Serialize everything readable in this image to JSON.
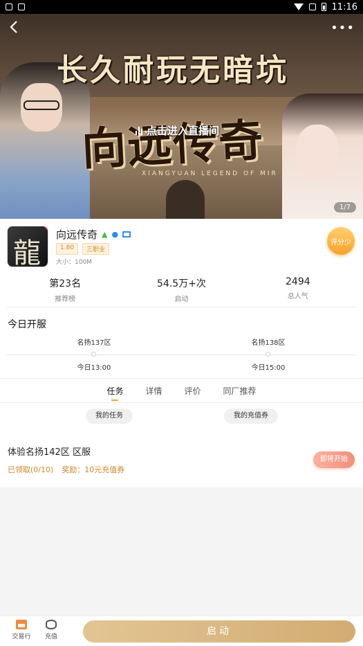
{
  "status_bar": {
    "time": "11:16"
  },
  "banner": {
    "slogan": "长久耐玩无暗坑",
    "game_logo": "向远传奇",
    "game_logo_sub": "XIANGYUAN LEGEND OF MIR",
    "live_label": "点击进入直播间",
    "page_indicator": "1/7"
  },
  "app": {
    "name": "向远传奇",
    "platform_icons": [
      "android-icon",
      "apple-icon",
      "pc-icon"
    ],
    "tags": [
      "1.80",
      "三职业"
    ],
    "size_label": "大小：100M",
    "rate_button": "评分少",
    "icon_char": "龍"
  },
  "stats": [
    {
      "value": "第23名",
      "label": "推荐榜"
    },
    {
      "value": "54.5万+次",
      "label": "启动"
    },
    {
      "value": "2494",
      "label": "总人气"
    }
  ],
  "today_servers": {
    "title": "今日开服",
    "servers": [
      {
        "name": "名扬137区",
        "time": "今日13:00"
      },
      {
        "name": "名扬138区",
        "time": "今日15:00"
      }
    ]
  },
  "tabs": [
    {
      "label": "任务",
      "active": true
    },
    {
      "label": "详情",
      "active": false
    },
    {
      "label": "评价",
      "active": false
    },
    {
      "label": "同厂推荐",
      "active": false
    }
  ],
  "sub_buttons": {
    "my_tasks": "我的任务",
    "my_coupons": "我的充值券"
  },
  "task": {
    "title": "体验名扬142区 区服",
    "claimed": "已领取(0/10)",
    "reward": "奖励：10元充值券",
    "button": "即将开始"
  },
  "bottom_bar": {
    "trade": "交易行",
    "recharge": "充值",
    "launch": "启动"
  },
  "colors": {
    "accent": "#f5a623",
    "reward": "#c9892a",
    "launch": "#d9b57f"
  }
}
